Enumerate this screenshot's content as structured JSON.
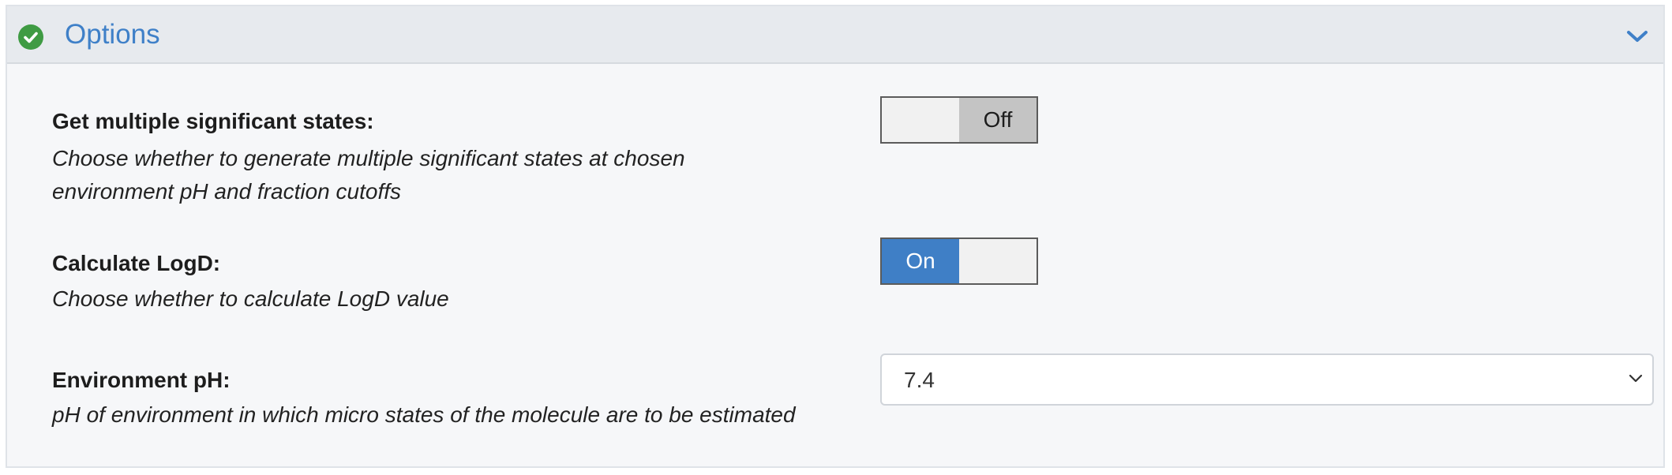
{
  "panel": {
    "title": "Options",
    "status_icon": "check-circle-icon",
    "collapse_icon": "chevron-down-icon",
    "accent_color": "#3f80c8",
    "status_color": "#3f9b43"
  },
  "options": [
    {
      "label": "Get multiple significant states:",
      "description": "Choose whether to generate multiple significant states at chosen environment pH and fraction cutoffs",
      "control": "toggle",
      "state": "Off",
      "on_label": "",
      "off_label": "Off"
    },
    {
      "label": "Calculate LogD:",
      "description": "Choose whether to calculate LogD value",
      "control": "toggle",
      "state": "On",
      "on_label": "On",
      "off_label": ""
    },
    {
      "label": "Environment pH:",
      "description": "pH of environment in which micro states of the molecule are to be estimated",
      "control": "select",
      "value": "7.4"
    }
  ]
}
